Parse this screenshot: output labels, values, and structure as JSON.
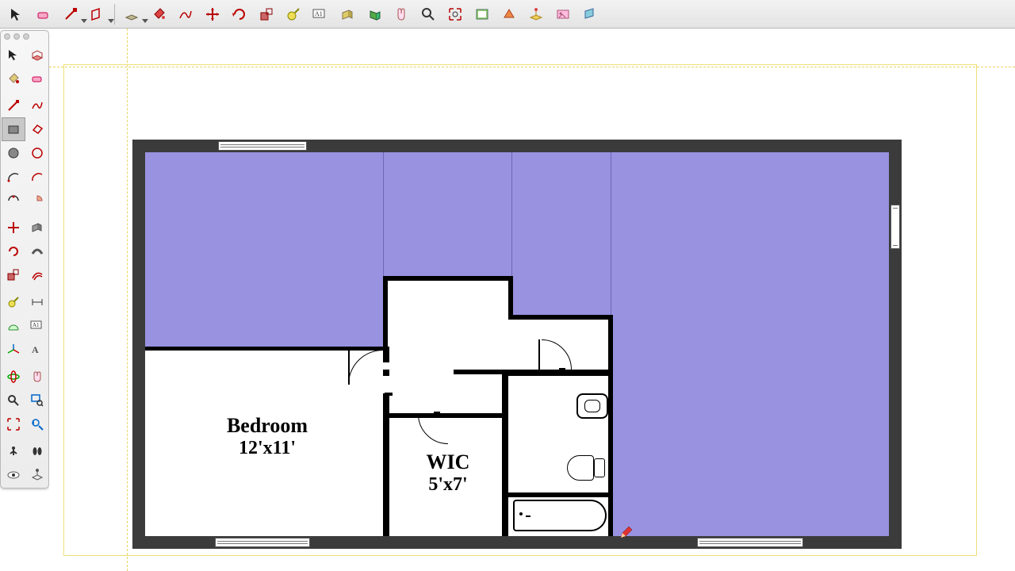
{
  "labels": {
    "bedroom_name": "Bedroom",
    "bedroom_dim": "12'x11'",
    "wic_name": "WIC",
    "wic_dim": "5'x7'"
  },
  "fill_color": "#9892e0",
  "top_toolbar": [
    "select-tool",
    "eraser-tool",
    "line-tool",
    "shape-tool",
    "rectangle-tool",
    "paint-bucket-tool",
    "freehand-tool",
    "move-tool",
    "rotate-tool",
    "scale-tool",
    "tape-measure-tool",
    "text-tool",
    "pushpull-tool",
    "followme-tool",
    "pan-tool",
    "zoom-tool",
    "zoom-extents-tool",
    "prev-view-tool",
    "walk-tool",
    "sandbox-tool",
    "image-tool",
    "section-tool"
  ],
  "left_palette": [
    "select-tool",
    "make-component-tool",
    "paint-tool",
    "eraser-tool",
    "pencil-tool",
    "freehand-tool",
    "rectangle-tool",
    "rotated-rect-tool",
    "circle-tool",
    "polygon-tool",
    "arc-tool",
    "2pt-arc-tool",
    "3pt-arc-tool",
    "pie-tool",
    "move-tool",
    "pushpull-tool",
    "rotate-tool",
    "followme-tool",
    "scale-tool",
    "offset-tool",
    "tape-tool",
    "dimension-tool",
    "protractor-tool",
    "text-tool",
    "axes-tool",
    "3dtext-tool",
    "orbit-tool",
    "pan-tool",
    "zoom-tool",
    "zoom-window-tool",
    "zoom-extents-tool",
    "prev-tool",
    "position-camera-tool",
    "walk-tool",
    "look-around-tool",
    "section-plane-tool"
  ]
}
